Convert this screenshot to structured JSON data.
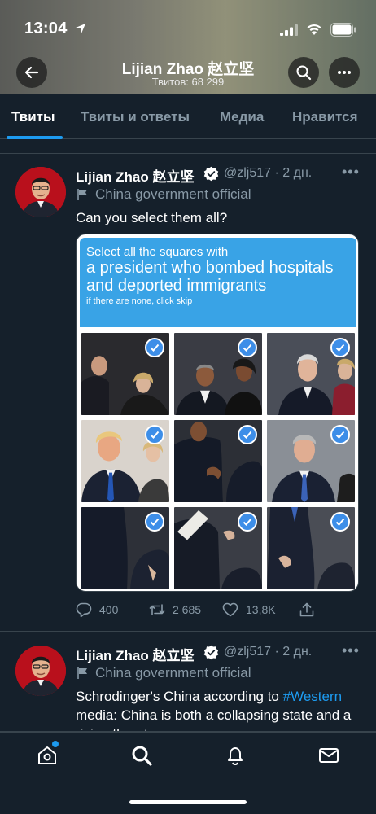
{
  "status_bar": {
    "time": "13:04"
  },
  "header": {
    "name": "Lijian Zhao 赵立坚",
    "tweet_count": "Твитов: 68 299"
  },
  "tabs": [
    {
      "label": "Твиты",
      "active": true
    },
    {
      "label": "Твиты и ответы",
      "active": false
    },
    {
      "label": "Медиа",
      "active": false
    },
    {
      "label": "Нравится",
      "active": false
    }
  ],
  "tweets": [
    {
      "author": "Lijian Zhao 赵立坚",
      "handle_time": "@zlj517 · 2 дн.",
      "label": "China government official",
      "text": "Can you select them all?",
      "captcha": {
        "line1": "Select all the squares with",
        "line2": "a president who bombed hospitals and deported immigrants",
        "line3": "if there are none, click skip"
      },
      "replies": "400",
      "retweets": "2 685",
      "likes": "13,8K"
    },
    {
      "author": "Lijian Zhao 赵立坚",
      "handle_time": "@zlj517 · 2 дн.",
      "label": "China government official",
      "text_before": "Schrodinger's China according to ",
      "hashtag": "#Western",
      "text_after": " media: China is both a collapsing state and a rising threat"
    }
  ],
  "icons": {
    "back": "arrow-left-icon",
    "search": "search-icon",
    "more": "more-horizontal-icon",
    "verified": "verified-badge-icon",
    "label": "flag-icon",
    "reply": "reply-icon",
    "retweet": "retweet-icon",
    "like": "heart-icon",
    "share": "share-icon",
    "nav": [
      "home-icon",
      "search-icon",
      "bell-icon",
      "mail-icon"
    ]
  },
  "colors": {
    "background": "#15202b",
    "accent": "#1d9bf0",
    "muted": "#8899a6",
    "captcha_blue": "#39a3e6"
  }
}
